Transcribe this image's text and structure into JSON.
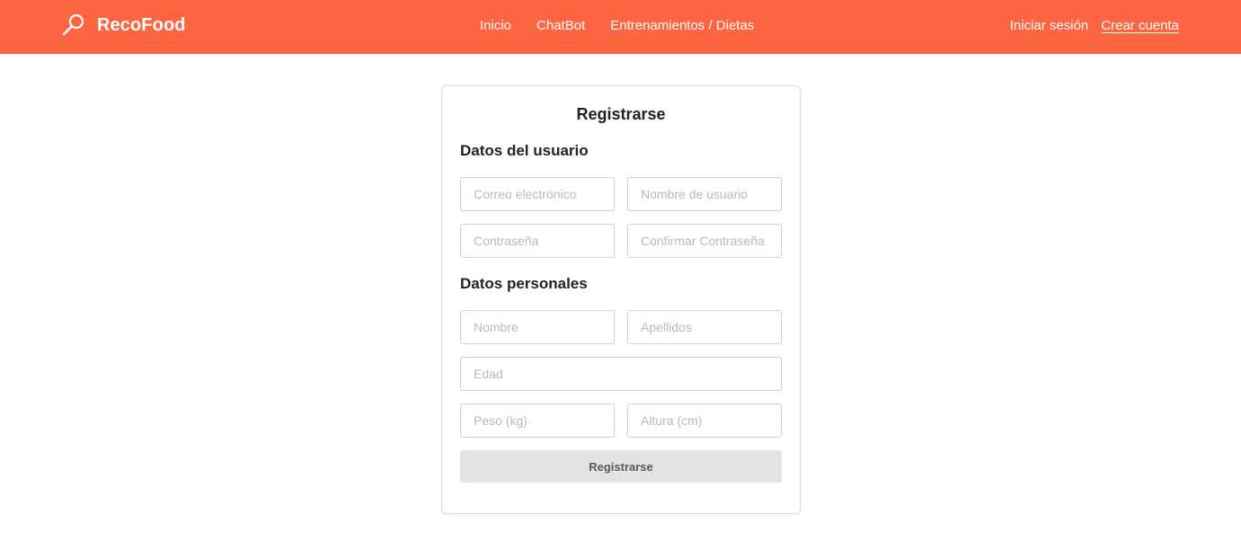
{
  "colors": {
    "navbar": "#fd6542",
    "button_bg": "#e2e3e5"
  },
  "brand": {
    "name": "RecoFood",
    "icon": "search-icon"
  },
  "nav": {
    "items": [
      {
        "label": "Inicio"
      },
      {
        "label": "ChatBot"
      },
      {
        "label": "Entrenamientos / Dietas"
      }
    ]
  },
  "auth": {
    "login": "Iniciar sesión",
    "register": "Crear cuenta"
  },
  "form": {
    "title": "Registrarse",
    "user_section": "Datos del usuario",
    "personal_section": "Datos personales",
    "email_placeholder": "Correo electrónico",
    "username_placeholder": "Nombre de usuario",
    "password_placeholder": "Contraseña",
    "confirm_password_placeholder": "Confirmar Contraseña",
    "name_placeholder": "Nombre",
    "surname_placeholder": "Apellidos",
    "age_placeholder": "Edad",
    "weight_placeholder": "Peso (kg)",
    "height_placeholder": "Altura (cm)",
    "submit_label": "Registrarse"
  }
}
